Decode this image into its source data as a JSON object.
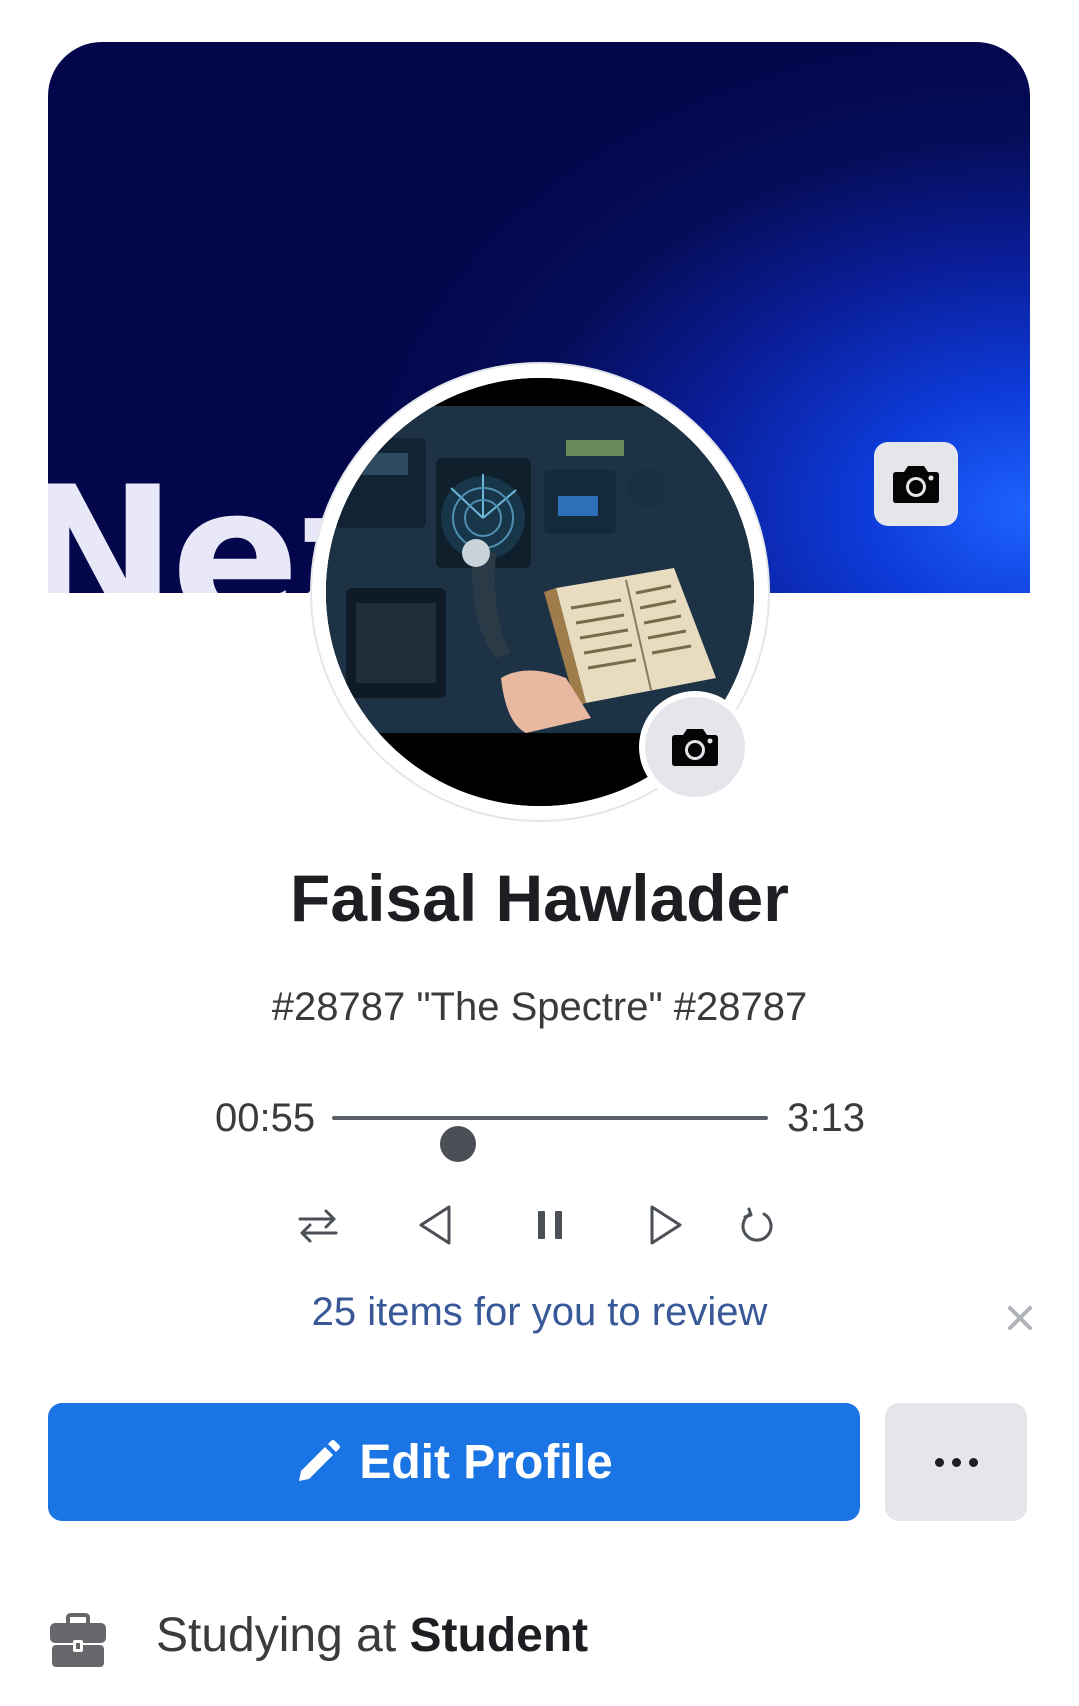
{
  "cover": {
    "text": "Nez"
  },
  "profile": {
    "name": "Faisal Hawlader",
    "bio": "#28787 \"The Spectre\" #28787"
  },
  "player": {
    "current_time": "00:55",
    "total_time": "3:13",
    "progress": 0.29
  },
  "review": {
    "text": "25 items for you to review"
  },
  "actions": {
    "edit_label": "Edit Profile"
  },
  "info": {
    "prefix": "Studying at ",
    "place": "Student"
  },
  "colors": {
    "accent": "#1b74e4",
    "link": "#385898",
    "button_gray": "#e4e6eb"
  },
  "icons": [
    "camera-icon",
    "shuffle-icon",
    "previous-icon",
    "pause-icon",
    "next-icon",
    "repeat-icon",
    "close-icon",
    "pencil-icon",
    "more-icon",
    "briefcase-icon"
  ]
}
